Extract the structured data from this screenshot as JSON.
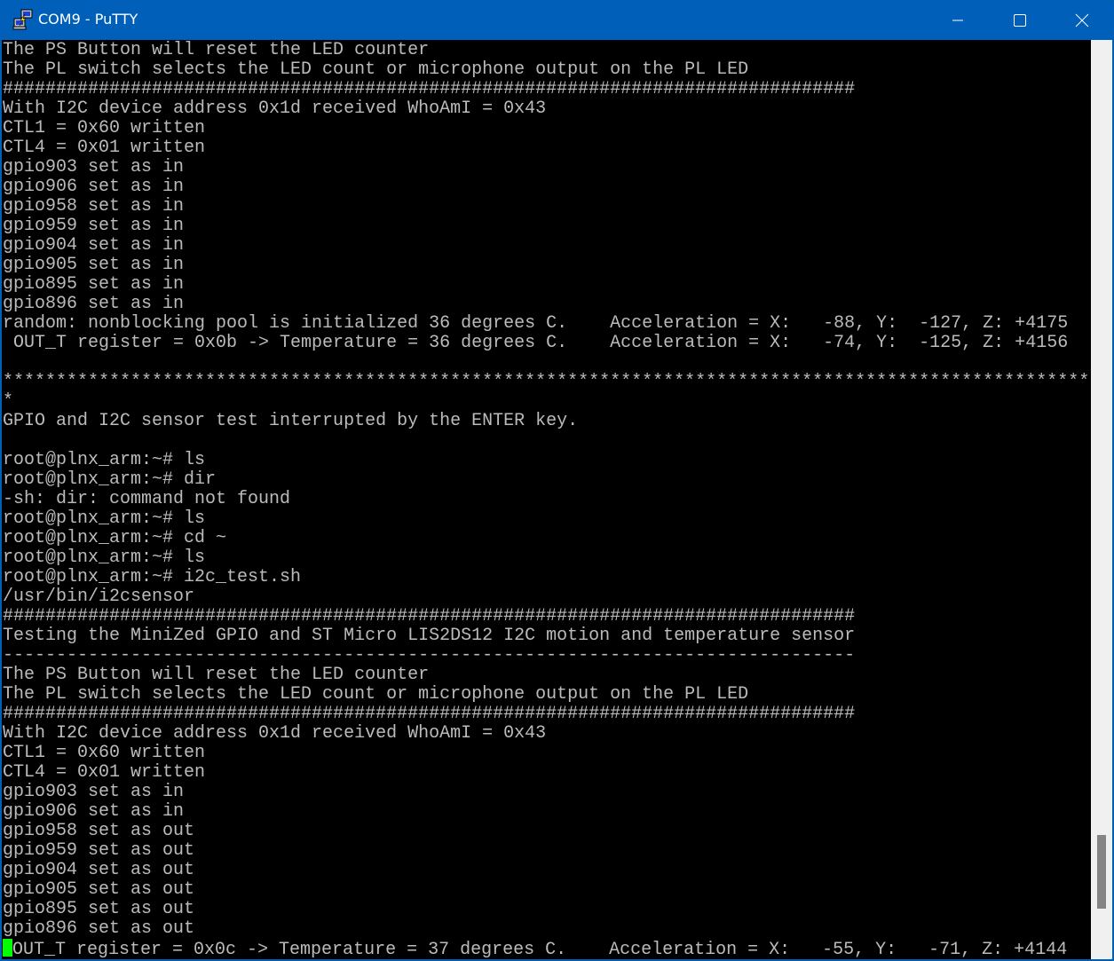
{
  "window": {
    "title": "COM9 - PuTTY",
    "app_icon": "putty-icon",
    "controls": {
      "minimize": "minimize-icon",
      "maximize": "maximize-icon",
      "close": "close-icon"
    }
  },
  "colors": {
    "titlebar": "#005fb8",
    "terminal_bg": "#000000",
    "terminal_fg": "#bbbbbb",
    "cursor": "#00ff00",
    "scrollbar_track": "#f0f0f0",
    "scrollbar_thumb": "#858585"
  },
  "terminal": {
    "lines": [
      "The PS Button will reset the LED counter",
      "The PL switch selects the LED count or microphone output on the PL LED",
      "################################################################################",
      "With I2C device address 0x1d received WhoAmI = 0x43",
      "CTL1 = 0x60 written",
      "CTL4 = 0x01 written",
      "gpio903 set as in",
      "gpio906 set as in",
      "gpio958 set as in",
      "gpio959 set as in",
      "gpio904 set as in",
      "gpio905 set as in",
      "gpio895 set as in",
      "gpio896 set as in",
      "random: nonblocking pool is initialized 36 degrees C.    Acceleration = X:   -88, Y:  -127, Z: +4175",
      " OUT_T register = 0x0b -> Temperature = 36 degrees C.    Acceleration = X:   -74, Y:  -125, Z: +4156",
      "",
      "******************************************************************************************************",
      "*",
      "GPIO and I2C sensor test interrupted by the ENTER key.",
      "",
      "root@plnx_arm:~# ls",
      "root@plnx_arm:~# dir",
      "-sh: dir: command not found",
      "root@plnx_arm:~# ls",
      "root@plnx_arm:~# cd ~",
      "root@plnx_arm:~# ls",
      "root@plnx_arm:~# i2c_test.sh",
      "/usr/bin/i2csensor",
      "################################################################################",
      "Testing the MiniZed GPIO and ST Micro LIS2DS12 I2C motion and temperature sensor",
      "--------------------------------------------------------------------------------",
      "The PS Button will reset the LED counter",
      "The PL switch selects the LED count or microphone output on the PL LED",
      "################################################################################",
      "With I2C device address 0x1d received WhoAmI = 0x43",
      "CTL1 = 0x60 written",
      "CTL4 = 0x01 written",
      "gpio903 set as in",
      "gpio906 set as in",
      "gpio958 set as out",
      "gpio959 set as out",
      "gpio904 set as out",
      "gpio905 set as out",
      "gpio895 set as out",
      "gpio896 set as out"
    ],
    "last_line": "OUT_T register = 0x0c -> Temperature = 37 degrees C.    Acceleration = X:   -55, Y:   -71, Z: +4144"
  },
  "scrollbar": {
    "position_fraction": 0.94,
    "visible_fraction": 0.08
  }
}
